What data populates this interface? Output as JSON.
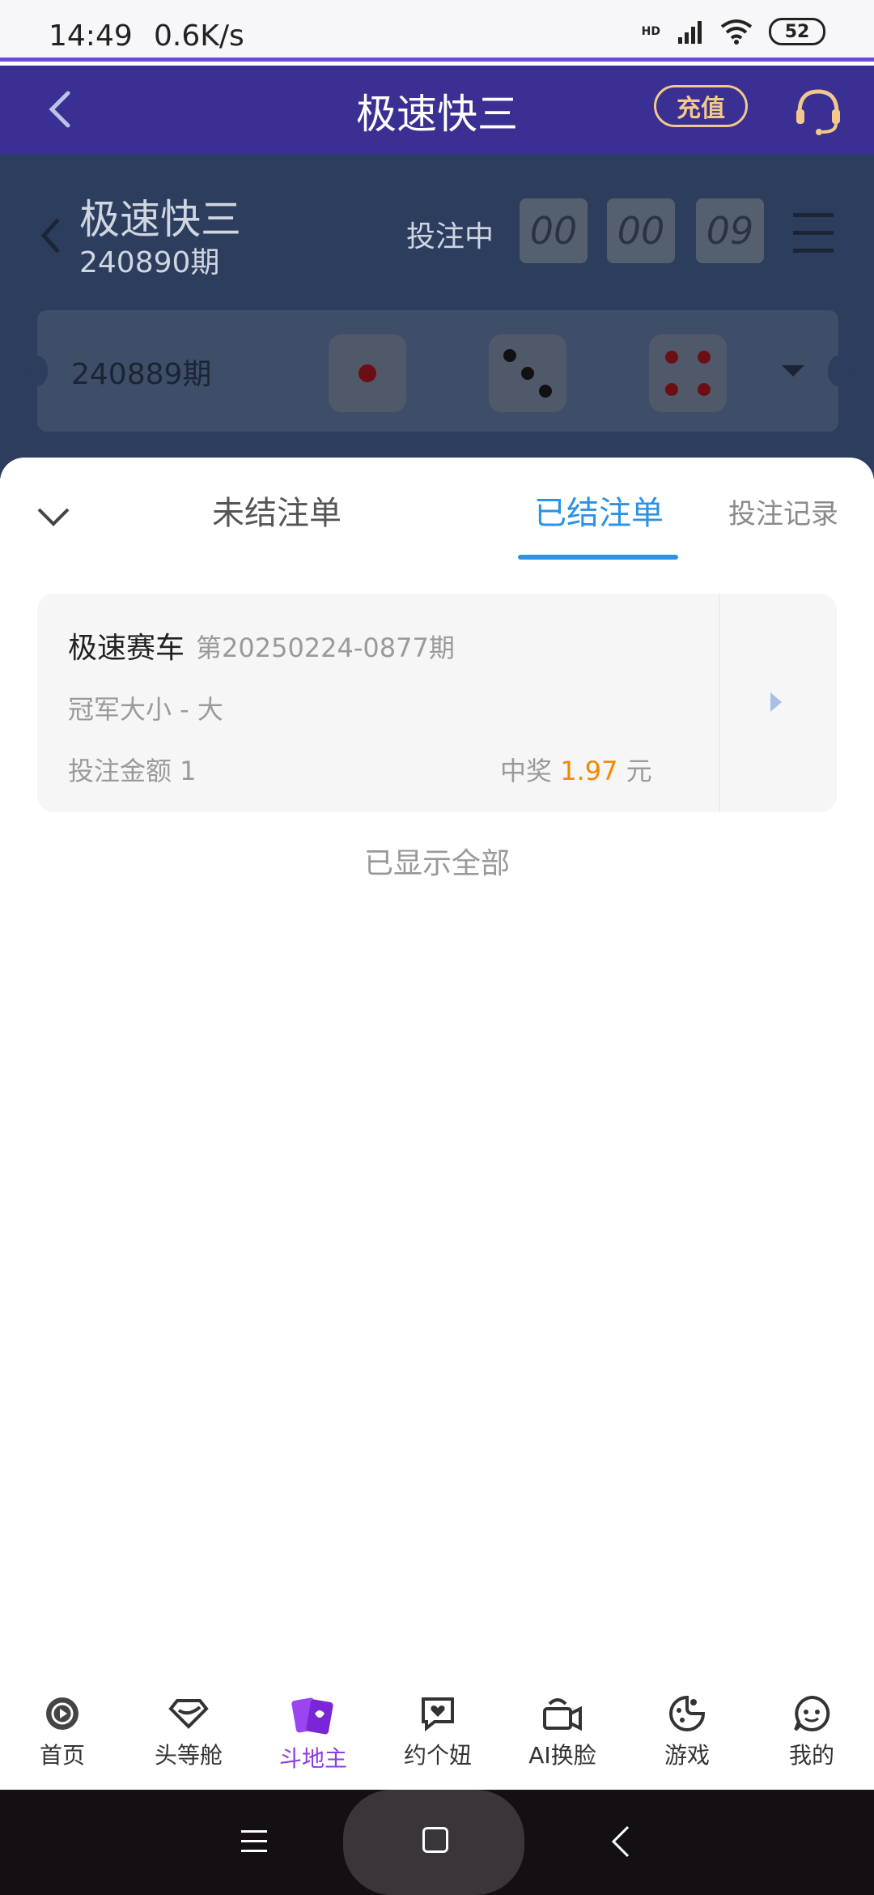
{
  "status_bar": {
    "time": "14:49",
    "speed": "0.6K/s",
    "network": "HD",
    "battery": "52"
  },
  "header": {
    "title": "极速快三",
    "recharge_label": "充值"
  },
  "game": {
    "title": "极速快三",
    "current_period": "240890期",
    "status": "投注中",
    "countdown": {
      "h": "00",
      "m": "00",
      "s": "09"
    },
    "last_period": "240889期",
    "last_dice": [
      1,
      3,
      4
    ]
  },
  "sheet": {
    "tabs": [
      "未结注单",
      "已结注单",
      "投注记录"
    ],
    "active_tab": 1,
    "bet": {
      "game": "极速赛车",
      "issue": "第20250224-0877期",
      "play": "冠军大小 - 大",
      "amount_text": "投注金额 1",
      "win_prefix": "中奖",
      "win_amount": "1.97",
      "win_unit": "元"
    },
    "footer": "已显示全部"
  },
  "tabbar": {
    "items": [
      "首页",
      "头等舱",
      "斗地主",
      "约个妞",
      "AI换脸",
      "游戏",
      "我的"
    ],
    "active": 2
  },
  "colors": {
    "header": "#3a2f93",
    "accent": "#2b92e6",
    "win": "#f08a00",
    "tab_active": "#8c3be6"
  }
}
